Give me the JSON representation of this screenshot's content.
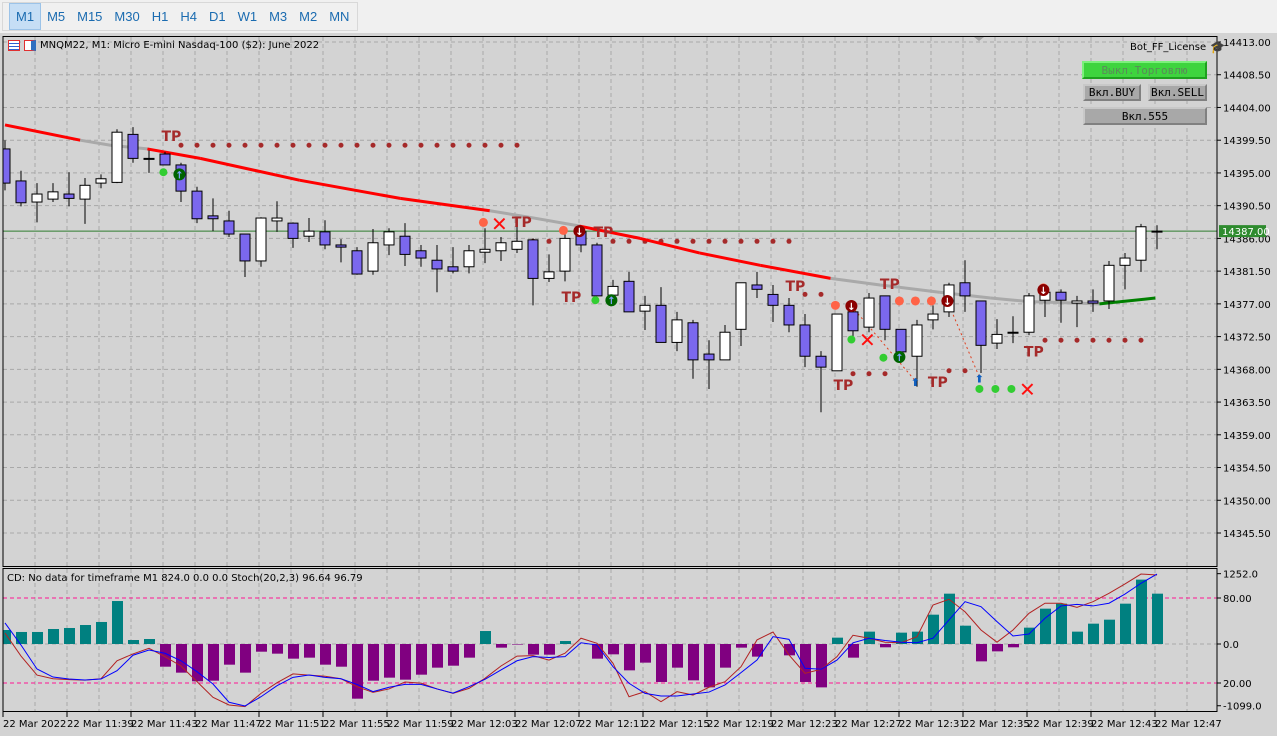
{
  "toolbar": {
    "timeframes": [
      "M1",
      "M5",
      "M15",
      "M30",
      "H1",
      "H4",
      "D1",
      "W1",
      "M3",
      "M2",
      "MN"
    ],
    "active": "M1"
  },
  "chart": {
    "title": "MNQM22, M1:  Micro E-mini Nasdaq-100 ($2): June 2022",
    "license_label": "Bot_FF_License",
    "buttons": {
      "trade_off": "Выкл.Торговлю",
      "buy_on": "Вкл.BUY",
      "sell_on": "Вкл.SELL",
      "on_555": "Вкл.555"
    },
    "current_price": "14387.00",
    "indicator_legend": "CD: No data for timeframe M1 824.0 0.0 0.0 Stoch(20,2,3) 96.64 96.79",
    "colors": {
      "bg": "#d3d3d3",
      "bull": "#ffffff",
      "bear": "#7b68ee",
      "ma_red": "#ff0000",
      "ma_gray": "#a9a9a9",
      "ma_green": "#008000",
      "hist_pos": "#008080",
      "hist_neg": "#800080",
      "stoch_main": "#0000ff",
      "stoch_signal": "#b22222",
      "level": "#ff1493",
      "price_tag": "#2e8b2e"
    }
  },
  "chart_data": {
    "type": "candlestick",
    "price_axis": {
      "max": 14413.0,
      "min": 14345.5,
      "ticks": [
        "14413.00",
        "14408.50",
        "14404.00",
        "14399.50",
        "14395.00",
        "14390.50",
        "14386.00",
        "14381.50",
        "14377.00",
        "14372.50",
        "14368.00",
        "14363.50",
        "14359.00",
        "14354.50",
        "14350.00",
        "14345.50"
      ]
    },
    "time_labels": [
      "22 Mar 2022",
      "22 Mar 11:39",
      "22 Mar 11:43",
      "22 Mar 11:47",
      "22 Mar 11:51",
      "22 Mar 11:55",
      "22 Mar 11:59",
      "22 Mar 12:03",
      "22 Mar 12:07",
      "22 Mar 12:11",
      "22 Mar 12:15",
      "22 Mar 12:19",
      "22 Mar 12:23",
      "22 Mar 12:27",
      "22 Mar 12:31",
      "22 Mar 12:35",
      "22 Mar 12:39",
      "22 Mar 12:43",
      "22 Mar 12:47"
    ],
    "ohlc": [
      [
        14398.3,
        14399.5,
        14392.6,
        14393.6
      ],
      [
        14393.9,
        14395.3,
        14390.4,
        14390.9
      ],
      [
        14391.0,
        14393.6,
        14388.2,
        14392.1
      ],
      [
        14391.4,
        14393.6,
        14391.0,
        14392.4
      ],
      [
        14392.1,
        14395.1,
        14390.4,
        14391.5
      ],
      [
        14391.4,
        14394.3,
        14388.0,
        14393.3
      ],
      [
        14393.6,
        14394.8,
        14392.9,
        14394.2
      ],
      [
        14393.7,
        14401.0,
        14393.6,
        14400.6
      ],
      [
        14400.3,
        14401.3,
        14396.4,
        14397.0
      ],
      [
        14397.0,
        14398.1,
        14395.0,
        14397.0
      ],
      [
        14397.6,
        14397.9,
        14396.1,
        14396.1
      ],
      [
        14396.1,
        14396.4,
        14391.0,
        14392.5
      ],
      [
        14392.5,
        14393.1,
        14388.1,
        14388.7
      ],
      [
        14389.1,
        14391.5,
        14387.0,
        14388.7
      ],
      [
        14388.4,
        14389.8,
        14386.2,
        14386.6
      ],
      [
        14386.6,
        14386.6,
        14380.7,
        14382.9
      ],
      [
        14382.9,
        14388.9,
        14382.1,
        14388.8
      ],
      [
        14388.4,
        14391.1,
        14386.9,
        14388.8
      ],
      [
        14388.1,
        14388.2,
        14384.7,
        14386.0
      ],
      [
        14386.3,
        14388.8,
        14385.5,
        14387.0
      ],
      [
        14386.9,
        14388.5,
        14384.5,
        14385.1
      ],
      [
        14385.1,
        14385.9,
        14382.7,
        14384.8
      ],
      [
        14384.3,
        14384.8,
        14381.0,
        14381.1
      ],
      [
        14381.5,
        14387.3,
        14381.0,
        14385.4
      ],
      [
        14385.1,
        14387.4,
        14383.7,
        14386.9
      ],
      [
        14386.3,
        14388.1,
        14382.2,
        14383.8
      ],
      [
        14384.3,
        14385.1,
        14382.1,
        14383.3
      ],
      [
        14383.0,
        14385.1,
        14378.6,
        14381.8
      ],
      [
        14382.1,
        14384.8,
        14381.2,
        14381.5
      ],
      [
        14382.1,
        14385.1,
        14381.2,
        14384.3
      ],
      [
        14384.1,
        14387.4,
        14382.6,
        14384.5
      ],
      [
        14384.3,
        14386.2,
        14382.9,
        14385.4
      ],
      [
        14384.5,
        14388.9,
        14384.0,
        14385.6
      ],
      [
        14385.8,
        14386.0,
        14376.8,
        14380.5
      ],
      [
        14380.5,
        14383.8,
        14380.0,
        14381.4
      ],
      [
        14381.5,
        14386.7,
        14380.1,
        14386.0
      ],
      [
        14386.9,
        14387.4,
        14384.1,
        14385.1
      ],
      [
        14385.1,
        14385.4,
        14378.1,
        14378.1
      ],
      [
        14378.2,
        14380.3,
        14377.8,
        14379.4
      ],
      [
        14380.1,
        14381.4,
        14375.9,
        14375.9
      ],
      [
        14376.0,
        14378.1,
        14373.4,
        14376.8
      ],
      [
        14376.8,
        14379.3,
        14371.7,
        14371.7
      ],
      [
        14371.7,
        14375.9,
        14370.5,
        14374.8
      ],
      [
        14374.4,
        14374.8,
        14366.7,
        14369.3
      ],
      [
        14370.1,
        14372.0,
        14365.3,
        14369.3
      ],
      [
        14369.3,
        14374.1,
        14369.3,
        14373.1
      ],
      [
        14373.5,
        14379.9,
        14371.2,
        14379.9
      ],
      [
        14379.6,
        14381.4,
        14377.8,
        14379.0
      ],
      [
        14378.3,
        14379.6,
        14374.5,
        14376.8
      ],
      [
        14376.8,
        14377.8,
        14373.1,
        14374.1
      ],
      [
        14374.1,
        14375.6,
        14368.3,
        14369.8
      ],
      [
        14369.8,
        14370.5,
        14362.1,
        14368.3
      ],
      [
        14367.8,
        14375.6,
        14367.8,
        14375.6
      ],
      [
        14375.9,
        14376.8,
        14372.0,
        14373.3
      ],
      [
        14373.8,
        14378.5,
        14373.1,
        14377.8
      ],
      [
        14378.1,
        14378.1,
        14372.0,
        14373.5
      ],
      [
        14373.5,
        14373.5,
        14368.9,
        14370.4
      ],
      [
        14369.8,
        14374.8,
        14365.6,
        14374.1
      ],
      [
        14374.8,
        14376.8,
        14373.5,
        14375.6
      ],
      [
        14375.9,
        14379.9,
        14375.2,
        14379.6
      ],
      [
        14379.9,
        14383.0,
        14375.9,
        14378.1
      ],
      [
        14377.4,
        14377.4,
        14367.5,
        14371.3
      ],
      [
        14371.6,
        14374.9,
        14370.8,
        14372.8
      ],
      [
        14373.1,
        14375.3,
        14371.6,
        14373.1
      ],
      [
        14373.1,
        14378.5,
        14372.7,
        14378.1
      ],
      [
        14377.5,
        14379.0,
        14375.2,
        14378.6
      ],
      [
        14378.6,
        14379.0,
        14374.4,
        14377.5
      ],
      [
        14377.1,
        14378.1,
        14373.8,
        14377.4
      ],
      [
        14377.4,
        14379.0,
        14375.9,
        14377.1
      ],
      [
        14377.4,
        14382.9,
        14376.3,
        14382.3
      ],
      [
        14382.3,
        14384.0,
        14379.0,
        14383.3
      ],
      [
        14383.0,
        14388.0,
        14381.4,
        14387.6
      ],
      [
        14387.0,
        14387.8,
        14384.5,
        14387.0
      ]
    ],
    "moving_average": [
      {
        "i": 0,
        "v": 14401.6,
        "c": "red"
      },
      {
        "i": 4.7,
        "v": 14399.5,
        "c": "gray"
      },
      {
        "i": 6.6,
        "v": 14398.8,
        "c": "gray"
      },
      {
        "i": 8.9,
        "v": 14398.3,
        "c": "red"
      },
      {
        "i": 12.2,
        "v": 14397.0,
        "c": "red"
      },
      {
        "i": 18.4,
        "v": 14394.0,
        "c": "red"
      },
      {
        "i": 24.7,
        "v": 14391.5,
        "c": "red"
      },
      {
        "i": 30.3,
        "v": 14389.8,
        "c": "gray"
      },
      {
        "i": 32.8,
        "v": 14388.9,
        "c": "gray"
      },
      {
        "i": 35.9,
        "v": 14387.7,
        "c": "red"
      },
      {
        "i": 39.7,
        "v": 14386.0,
        "c": "red"
      },
      {
        "i": 43.4,
        "v": 14384.0,
        "c": "red"
      },
      {
        "i": 47.2,
        "v": 14382.3,
        "c": "red"
      },
      {
        "i": 51.6,
        "v": 14380.5,
        "c": "gray"
      },
      {
        "i": 54.7,
        "v": 14379.6,
        "c": "gray"
      },
      {
        "i": 58.4,
        "v": 14378.6,
        "c": "gray"
      },
      {
        "i": 61.6,
        "v": 14377.8,
        "c": "gray"
      },
      {
        "i": 64.1,
        "v": 14377.3,
        "c": "gray"
      },
      {
        "i": 68.4,
        "v": 14377.0,
        "c": "green"
      },
      {
        "i": 71.9,
        "v": 14377.8,
        "c": "green"
      }
    ],
    "tp_labels": [
      {
        "i": 10.4,
        "p": 14400.2,
        "text": "TP"
      },
      {
        "i": 32.3,
        "p": 14388.4,
        "text": "TP"
      },
      {
        "i": 37.4,
        "p": 14387.0,
        "text": "TP"
      },
      {
        "i": 35.4,
        "p": 14378.1,
        "text": "TP"
      },
      {
        "i": 49.4,
        "p": 14379.6,
        "text": "TP"
      },
      {
        "i": 52.4,
        "p": 14366.0,
        "text": "TP"
      },
      {
        "i": 55.3,
        "p": 14379.9,
        "text": "TP"
      },
      {
        "i": 58.3,
        "p": 14366.4,
        "text": "TP"
      },
      {
        "i": 64.3,
        "p": 14370.6,
        "text": "TP"
      }
    ],
    "tp_dot_rows": [
      {
        "p": 14398.8,
        "from": 11,
        "to": 32
      },
      {
        "p": 14385.6,
        "from": 33,
        "to": 34
      },
      {
        "p": 14385.6,
        "from": 38,
        "to": 49
      },
      {
        "p": 14378.3,
        "from": 50,
        "to": 51
      },
      {
        "p": 14367.4,
        "from": 53,
        "to": 55
      },
      {
        "p": 14367.8,
        "from": 59,
        "to": 60
      },
      {
        "p": 14372.0,
        "from": 65,
        "to": 71
      }
    ],
    "entry_dots": [
      {
        "i": 29.9,
        "p": 14388.2
      },
      {
        "i": 34.9,
        "p": 14387.1
      },
      {
        "i": 51.9,
        "p": 14376.8
      },
      {
        "i": 55.9,
        "p": 14377.4
      },
      {
        "i": 56.9,
        "p": 14377.4
      },
      {
        "i": 57.9,
        "p": 14377.4
      },
      {
        "i": 64.9,
        "p": 14379.2
      }
    ],
    "stop_dots": [
      {
        "i": 9.9,
        "p": 14395.1
      },
      {
        "i": 36.9,
        "p": 14377.5
      },
      {
        "i": 52.9,
        "p": 14372.1
      },
      {
        "i": 54.9,
        "p": 14369.6
      },
      {
        "i": 60.9,
        "p": 14365.3
      },
      {
        "i": 61.9,
        "p": 14365.3
      },
      {
        "i": 62.9,
        "p": 14365.3
      }
    ],
    "close_marks": [
      {
        "i": 30.9,
        "p": 14388.0
      },
      {
        "i": 53.9,
        "p": 14372.0
      },
      {
        "i": 63.9,
        "p": 14365.2
      }
    ],
    "signal_circles": [
      {
        "i": 10.9,
        "p": 14394.8,
        "dir": "up"
      },
      {
        "i": 35.9,
        "p": 14387.0,
        "dir": "down"
      },
      {
        "i": 37.9,
        "p": 14377.5,
        "dir": "up"
      },
      {
        "i": 52.9,
        "p": 14376.7,
        "dir": "down"
      },
      {
        "i": 55.9,
        "p": 14369.7,
        "dir": "up"
      },
      {
        "i": 58.9,
        "p": 14377.4,
        "dir": "down"
      },
      {
        "i": 64.9,
        "p": 14378.9,
        "dir": "down"
      }
    ],
    "buy_arrows": [
      {
        "i": 56.9,
        "p": 14366.4,
        "from_i": 52.9,
        "from_p": 14376.7
      },
      {
        "i": 60.9,
        "p": 14366.9,
        "from_i": 58.9,
        "from_p": 14377.4
      }
    ],
    "indicator": {
      "scale_labels": [
        {
          "text": "1252.0",
          "v": 1252
        },
        {
          "text": "80.00",
          "stoch": 80
        },
        {
          "text": "0.0",
          "v": 0
        },
        {
          "text": "20.00",
          "stoch": 20
        },
        {
          "text": "-1099.0",
          "v": -1099
        }
      ],
      "levels": [
        80,
        20
      ],
      "histogram": [
        249,
        214,
        214,
        267,
        285,
        338,
        392,
        765,
        71,
        89,
        -404,
        -510,
        -664,
        -653,
        -368,
        -510,
        -137,
        -172,
        -261,
        -243,
        -368,
        -404,
        -973,
        -653,
        -599,
        -635,
        -546,
        -421,
        -386,
        -243,
        231,
        -65,
        -10,
        -190,
        -190,
        53,
        0,
        -261,
        -184,
        -469,
        -332,
        -676,
        -421,
        -647,
        -772,
        -421,
        -65,
        -225,
        0,
        -202,
        -676,
        -772,
        113,
        -243,
        220,
        -59,
        202,
        220,
        522,
        896,
        326,
        -309,
        -131,
        -59,
        291,
        629,
        718,
        220,
        362,
        433,
        718,
        1146,
        896
      ],
      "stoch_main": [
        62.4,
        46.8,
        29.9,
        24.2,
        22.8,
        22.1,
        22.8,
        28.7,
        39.6,
        43.3,
        41,
        35.7,
        28,
        19.3,
        6.4,
        3.8,
        10.3,
        18.1,
        24,
        25.6,
        24,
        23,
        19,
        13.9,
        17,
        19,
        19,
        15.8,
        12.9,
        17.4,
        22.6,
        29.2,
        35.7,
        38.6,
        38,
        38.6,
        48.4,
        46.8,
        31.5,
        19.8,
        12.7,
        10.8,
        10.8,
        12.2,
        13.6,
        18.6,
        27.3,
        36.2,
        52.7,
        50.8,
        30.4,
        29.7,
        36.2,
        48.4,
        51.6,
        50,
        48.8,
        48.4,
        51.6,
        64.5,
        77.4,
        73.9,
        63.3,
        53.2,
        54.6,
        65.7,
        74.4,
        75.5,
        74.4,
        76.3,
        82.8,
        90.4,
        96.9
      ],
      "stoch_signal": [
        55.3,
        39,
        25.6,
        23,
        22.4,
        22,
        23,
        35.7,
        40.5,
        44.5,
        38.6,
        32,
        21,
        9.9,
        4.5,
        3.3,
        12.7,
        20.2,
        26.4,
        25.6,
        24.8,
        23,
        17.4,
        13.4,
        15.8,
        20.7,
        19.9,
        15.8,
        12.7,
        16.2,
        23.3,
        32,
        39,
        39.3,
        36.2,
        41,
        51.6,
        48,
        33.9,
        10.3,
        13.9,
        6.8,
        13.9,
        11.5,
        17,
        20.9,
        31.5,
        50.4,
        56,
        39.8,
        26.8,
        29.7,
        38.6,
        53.7,
        51.6,
        48.8,
        48.4,
        52.7,
        75,
        79.1,
        70.3,
        57.4,
        48.8,
        57.4,
        69.2,
        76.3,
        76.3,
        73.4,
        77.4,
        83.3,
        89.9,
        96.9,
        96.2
      ]
    }
  }
}
